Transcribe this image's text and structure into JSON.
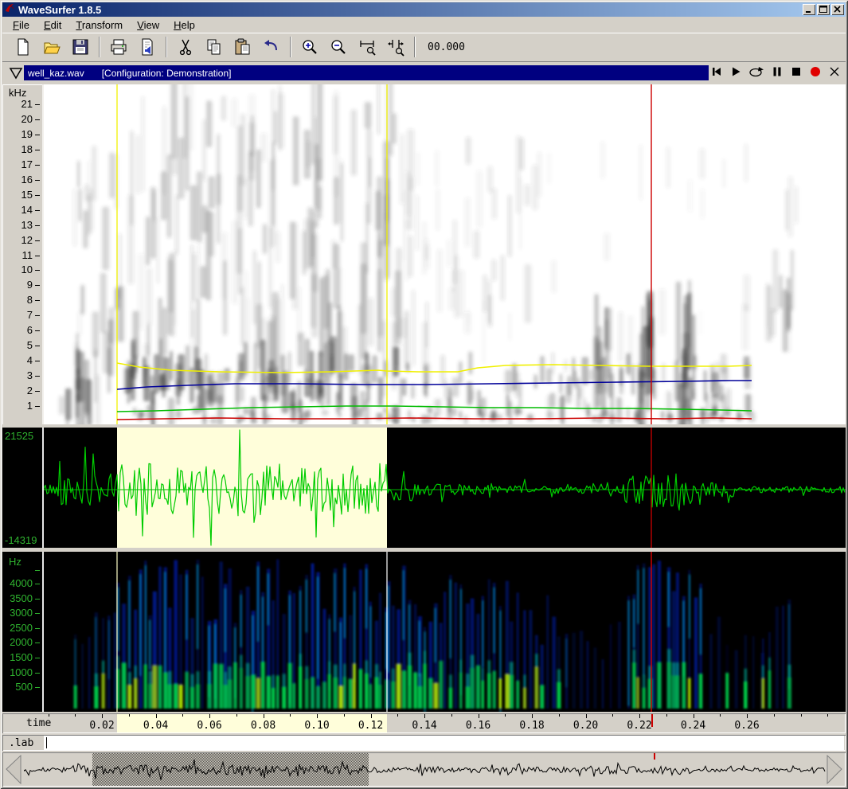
{
  "window": {
    "title": "WaveSurfer 1.8.5"
  },
  "menu": {
    "items": [
      {
        "label": "File",
        "underline": 0
      },
      {
        "label": "Edit",
        "underline": 0
      },
      {
        "label": "Transform",
        "underline": 0
      },
      {
        "label": "View",
        "underline": 0
      },
      {
        "label": "Help",
        "underline": 0
      }
    ]
  },
  "toolbar": {
    "time_display": "00.000",
    "buttons": [
      "new",
      "open",
      "save",
      "print",
      "properties",
      "cut",
      "copy",
      "paste",
      "undo",
      "zoom-in",
      "zoom-out",
      "zoom-selection",
      "zoom-all"
    ]
  },
  "pane_header": {
    "filename": "well_kaz.wav",
    "configuration": "[Configuration: Demonstration]",
    "transport": [
      "skip-to-start",
      "play",
      "play-loop",
      "pause",
      "stop",
      "record",
      "close"
    ]
  },
  "spectrogram_pane": {
    "unit": "kHz",
    "ticks": [
      "21",
      "20",
      "19",
      "18",
      "17",
      "16",
      "15",
      "14",
      "13",
      "12",
      "11",
      "10",
      "9",
      "8",
      "7",
      "6",
      "5",
      "4",
      "3",
      "2",
      "1"
    ]
  },
  "waveform_pane": {
    "max": "21525",
    "min": "-14319"
  },
  "spectrogram2_pane": {
    "unit": "Hz",
    "ticks": [
      "4000",
      "3500",
      "3000",
      "2500",
      "2000",
      "1500",
      "1000",
      "500"
    ]
  },
  "time_axis": {
    "label": "time",
    "ticks": [
      "0.02",
      "0.04",
      "0.06",
      "0.08",
      "0.10",
      "0.12",
      "0.14",
      "0.16",
      "0.18",
      "0.20",
      "0.22",
      "0.24",
      "0.26"
    ]
  },
  "label_track": {
    "name": ".lab"
  },
  "selection": {
    "start_s": 0.026,
    "end_s": 0.125
  },
  "cursor": {
    "time_s": 0.222
  },
  "colors": {
    "window_bg": "#d4d0c8",
    "titlebar_left": "#0a246a",
    "titlebar_right": "#a6caf0",
    "pane_title_bg": "#000080",
    "selection_fill": "#fffeda",
    "waveform_green": "#00cc00",
    "axis_green": "#2fb32f",
    "cursor_red": "#cc0000",
    "formant_yellow": "#f0f000",
    "formant_blue": "#000099",
    "formant_green": "#00bb00",
    "formant_red": "#cc0000"
  }
}
